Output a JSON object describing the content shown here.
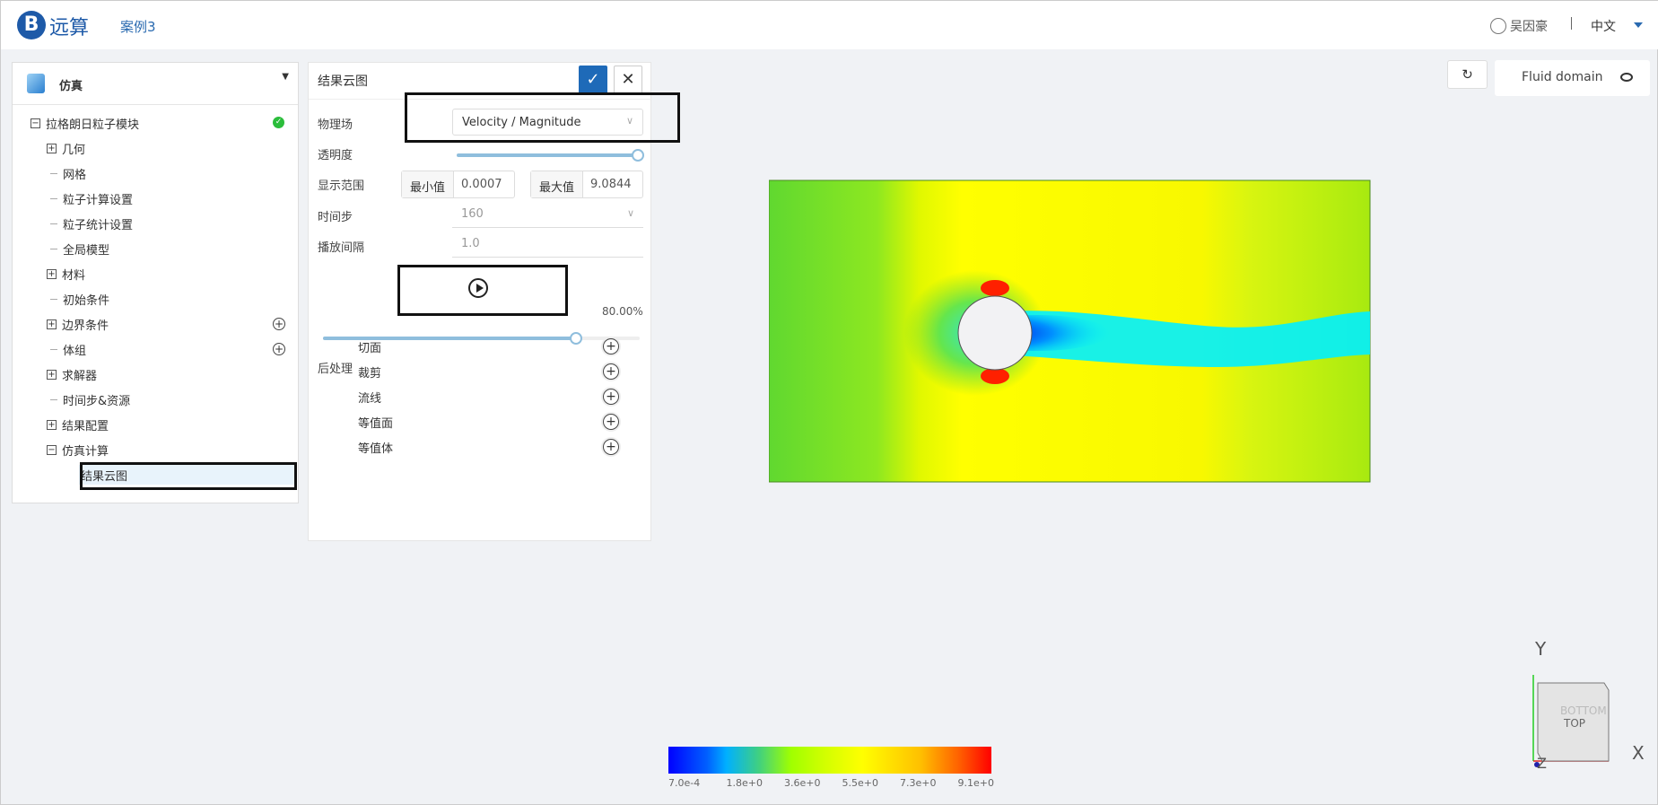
{
  "header": {
    "logo_text": "B",
    "brand": "远算",
    "case": "案例3",
    "user": "吴因豪",
    "language": "中文"
  },
  "left_panel": {
    "title": "仿真",
    "tree": [
      {
        "label": "拉格朗日粒子模块",
        "toggle": "−",
        "status": "ok"
      },
      {
        "label": "几何",
        "toggle": "+"
      },
      {
        "label": "网格"
      },
      {
        "label": "粒子计算设置"
      },
      {
        "label": "粒子统计设置"
      },
      {
        "label": "全局模型"
      },
      {
        "label": "材料",
        "toggle": "+"
      },
      {
        "label": "初始条件"
      },
      {
        "label": "边界条件",
        "toggle": "+",
        "add": true
      },
      {
        "label": "体组",
        "add": true
      },
      {
        "label": "求解器",
        "toggle": "+"
      },
      {
        "label": "时间步&资源"
      },
      {
        "label": "结果配置",
        "toggle": "+"
      },
      {
        "label": "仿真计算",
        "toggle": "−"
      },
      {
        "label": "结果云图",
        "selected": true
      }
    ]
  },
  "contour_panel": {
    "title": "结果云图",
    "confirm": "✓",
    "close": "✕",
    "field_label": "物理场",
    "field_value": "Velocity / Magnitude",
    "opacity_label": "透明度",
    "opacity": 1.0,
    "range_label": "显示范围",
    "min_label": "最小值",
    "min_value": "0.0007",
    "max_label": "最大值",
    "max_value": "9.0844",
    "timestep_label": "时间步",
    "timestep_value": "160",
    "interval_label": "播放间隔",
    "interval_value": "1.0",
    "progress_text": "80.00%",
    "progress": 0.8,
    "post_label": "后处理",
    "post_items": [
      "切面",
      "裁剪",
      "流线",
      "等值面",
      "等值体"
    ]
  },
  "viewer": {
    "domain_label": "Fluid domain",
    "axes": {
      "x": "X",
      "y": "Y",
      "z": "Z",
      "face": "TOP",
      "back_face": "BOTTOM"
    },
    "colorbar": {
      "labels": [
        "7.0e-4",
        "1.8e+0",
        "3.6e+0",
        "5.5e+0",
        "7.3e+0",
        "9.1e+0"
      ],
      "colors": [
        "#0000ff",
        "#00b0ff",
        "#a0ff00",
        "#ffff00",
        "#ffc000",
        "#ff0000"
      ]
    }
  }
}
